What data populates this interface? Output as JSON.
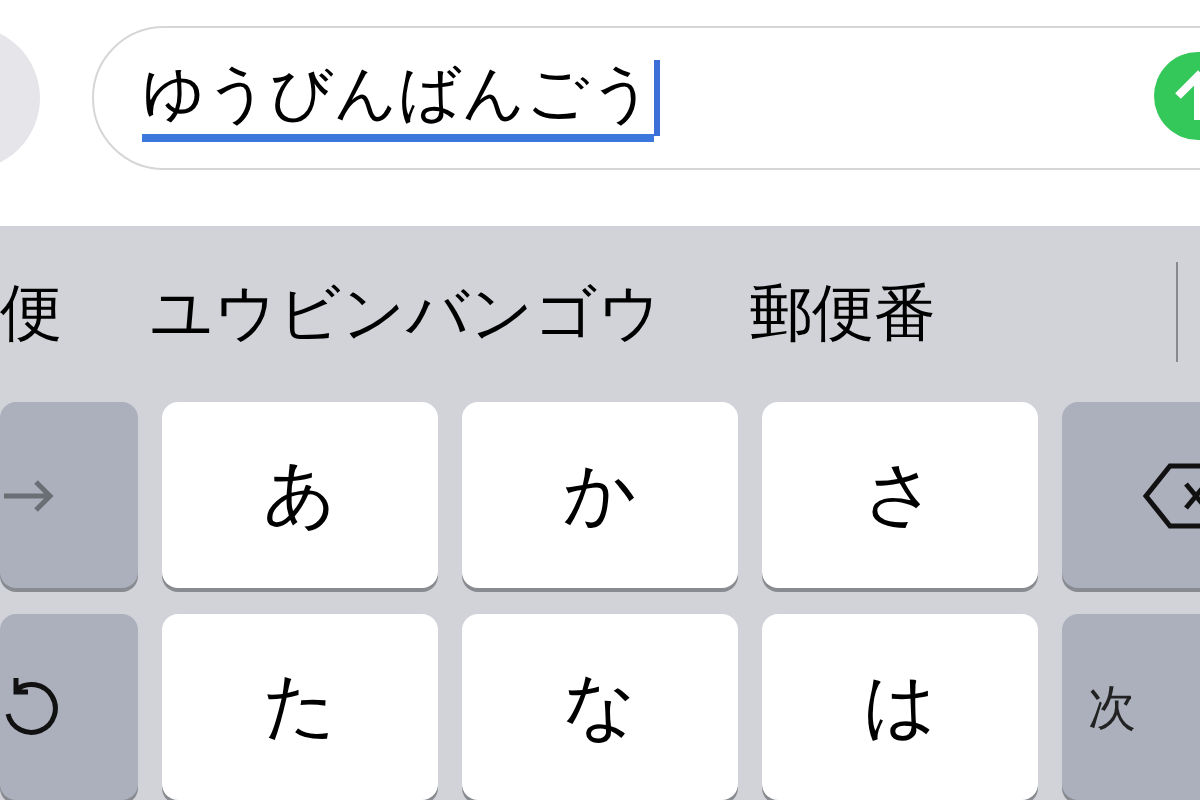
{
  "input": {
    "value": "ゆうびんばんごう",
    "composing": true
  },
  "candidates": [
    "便",
    "ユウビンバンゴウ",
    "郵便番"
  ],
  "keys": [
    [
      {
        "kind": "arrow"
      },
      {
        "kind": "char",
        "label": "あ"
      },
      {
        "kind": "char",
        "label": "か"
      },
      {
        "kind": "char",
        "label": "さ"
      },
      {
        "kind": "backspace"
      }
    ],
    [
      {
        "kind": "undo"
      },
      {
        "kind": "char",
        "label": "た"
      },
      {
        "kind": "char",
        "label": "な"
      },
      {
        "kind": "char",
        "label": "は"
      },
      {
        "kind": "text",
        "label": "次"
      }
    ]
  ]
}
